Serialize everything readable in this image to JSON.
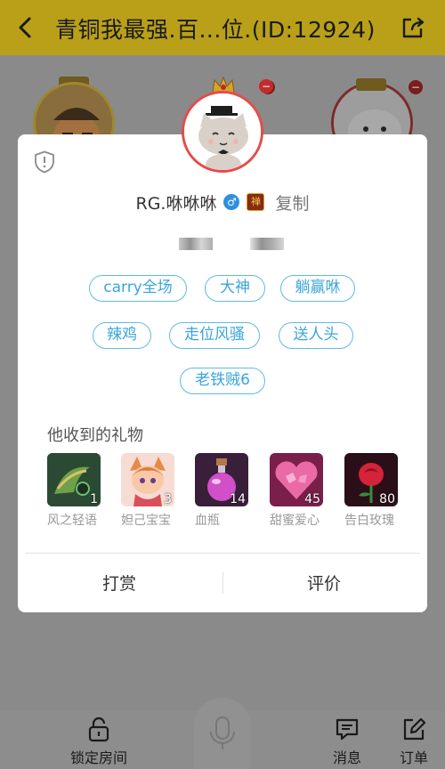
{
  "header": {
    "title": "青铜我最强.百...位.(ID:12924)"
  },
  "icons": {
    "back": "back-chevron-icon",
    "share": "share-icon",
    "shield": "shield-report-icon",
    "lock": "lock-icon",
    "mic": "microphone-icon",
    "message": "message-icon",
    "order": "edit-order-icon"
  },
  "colors": {
    "accent_blue": "#39a6da",
    "header_gold": "#b9a018",
    "avatar_ring": "#e64b4b"
  },
  "profile": {
    "username": "RG.咻咻咻",
    "gender_symbol": "♂",
    "rank_badge": "禅",
    "copy_label": "复制"
  },
  "tags": [
    "carry全场",
    "大神",
    "躺赢咻",
    "辣鸡",
    "走位风骚",
    "送人头",
    "老铁贼6"
  ],
  "gifts": {
    "title": "他收到的礼物",
    "items": [
      {
        "name": "风之轻语",
        "count": "1"
      },
      {
        "name": "妲己宝宝",
        "count": "3"
      },
      {
        "name": "血瓶",
        "count": "14"
      },
      {
        "name": "甜蜜爱心",
        "count": "45"
      },
      {
        "name": "告白玫瑰",
        "count": "80"
      }
    ]
  },
  "actions": {
    "reward": "打赏",
    "review": "评价"
  },
  "bottom_bar": {
    "lock_room": "锁定房间",
    "messages": "消息",
    "orders": "订单"
  }
}
